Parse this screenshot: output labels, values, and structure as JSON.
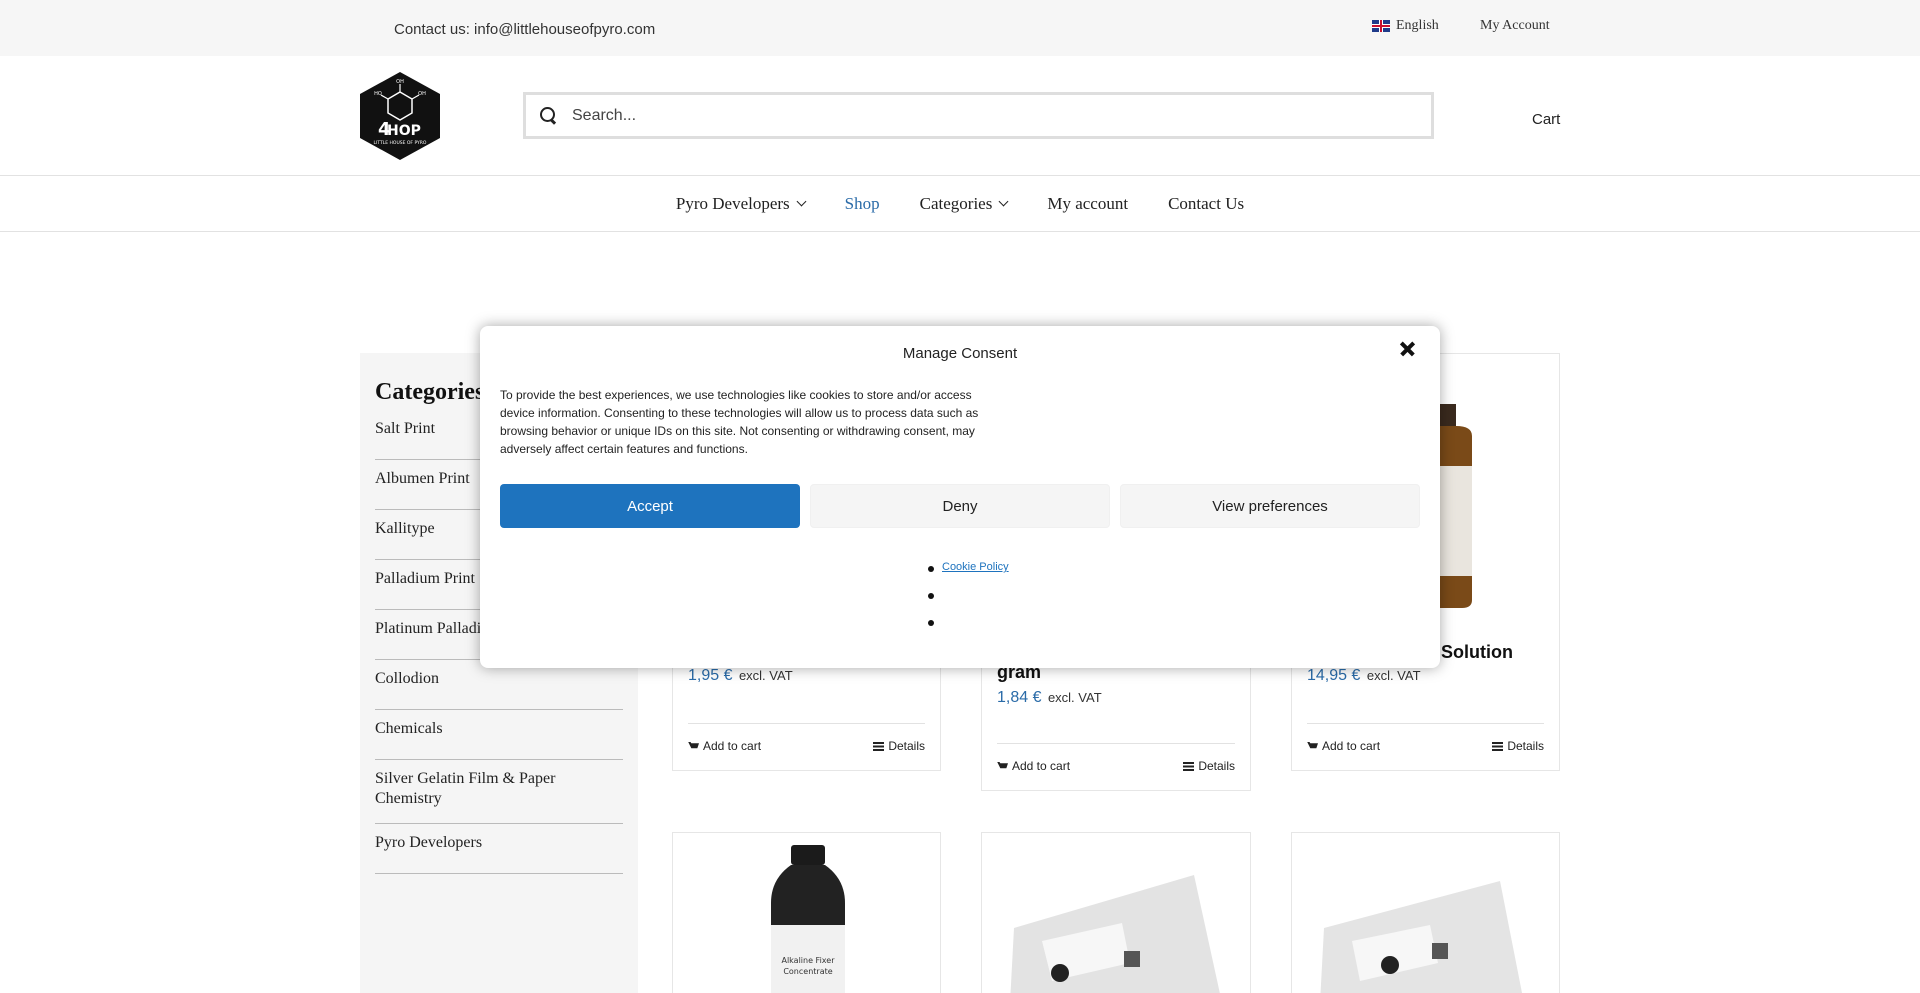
{
  "topbar": {
    "contact": "Contact us: info@littlehouseofpyro.com",
    "language": "English",
    "my_account": "My Account"
  },
  "header": {
    "logo_text": "HOP",
    "logo_small": "LITTLE HOUSE OF PYRO",
    "search_placeholder": "Search...",
    "cart": "Cart"
  },
  "nav": {
    "items": [
      {
        "label": "Pyro Developers",
        "icon": "chevron-down-icon"
      },
      {
        "label": "Shop"
      },
      {
        "label": "Categories",
        "icon": "chevron-down-icon"
      },
      {
        "label": "My account"
      },
      {
        "label": "Contact Us"
      }
    ],
    "active_color": "#2a6ba8"
  },
  "sidebar": {
    "title": "Categories",
    "items": [
      "Salt Print",
      "Albumen Print",
      "Kallitype",
      "Palladium Print",
      "Platinum Palladium Print",
      "Collodion",
      "Chemicals",
      "Silver Gelatin Film & Paper Chemistry",
      "Pyro Developers"
    ]
  },
  "products": [
    {
      "title": "",
      "price": "1,95 €",
      "vat": "excl. VAT",
      "add_to_cart": "Add to cart",
      "details": "Details"
    },
    {
      "title": "gram",
      "price": "1,84 €",
      "vat": "excl. VAT",
      "add_to_cart": "Add to cart",
      "details": "Details"
    },
    {
      "title": "Solution",
      "price": "14,95 €",
      "vat": "excl. VAT",
      "add_to_cart": "Add to cart",
      "details": "Details"
    },
    {
      "label_1": "Alkaline Fixer",
      "label_2": "Concentrate"
    }
  ],
  "consent": {
    "title": "Manage Consent",
    "body": "To provide the best experiences, we use technologies like cookies to store and/or access device information. Consenting to these technologies will allow us to process data such as browsing behavior or unique IDs on this site. Not consenting or withdrawing consent, may adversely affect certain features and functions.",
    "accept": "Accept",
    "deny": "Deny",
    "preferences": "View preferences",
    "links": [
      "Cookie Policy",
      "",
      ""
    ],
    "accept_color": "#1e73be"
  }
}
